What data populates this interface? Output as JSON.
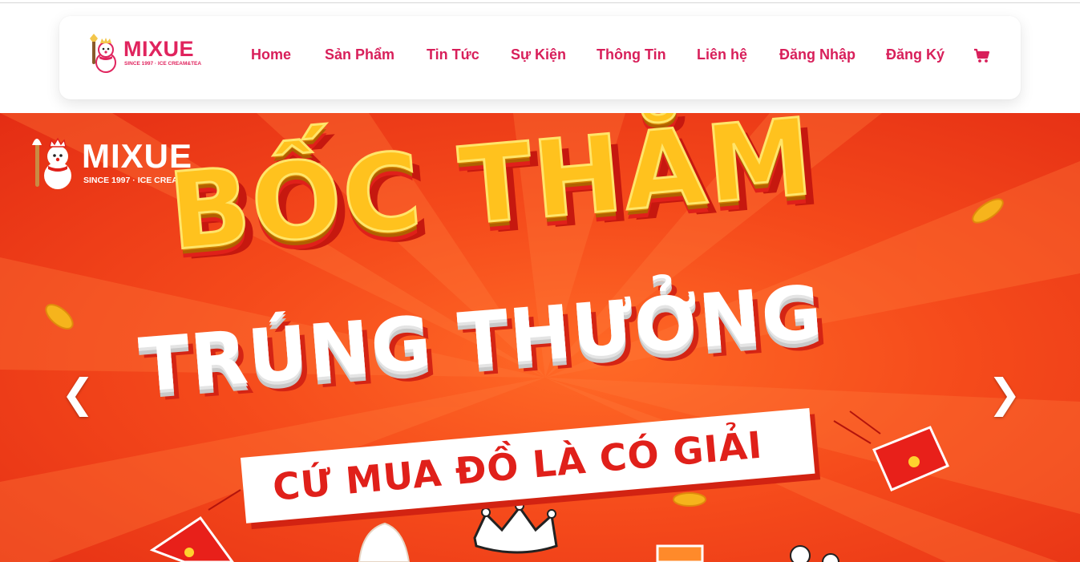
{
  "brand": {
    "name": "MIXUE",
    "tagline": "SINCE 1997 · ICE CREAM&TEA",
    "color": "#e0245e"
  },
  "nav": {
    "items": [
      {
        "label": "Home"
      },
      {
        "label": "Sản Phẩm"
      },
      {
        "label": "Tin Tức"
      },
      {
        "label": "Sự Kiện"
      },
      {
        "label": "Thông Tin"
      },
      {
        "label": "Liên hệ"
      },
      {
        "label": "Đăng Nhập"
      },
      {
        "label": "Đăng Ký"
      }
    ],
    "cart_icon": "shopping-cart-icon",
    "color": "#d81f5a"
  },
  "banner": {
    "logo_name": "MIXUE",
    "logo_tagline": "SINCE 1997 · ICE CREAM & TEA",
    "headline_1": "BỐC THĂM",
    "headline_2": "TRÚNG THƯỞNG",
    "tagline": "CỨ MUA ĐỒ LÀ CÓ GIẢI",
    "prev_arrow": "❮",
    "next_arrow": "❯",
    "background_color": "#f54a1b",
    "headline_color": "#ffc21e"
  }
}
